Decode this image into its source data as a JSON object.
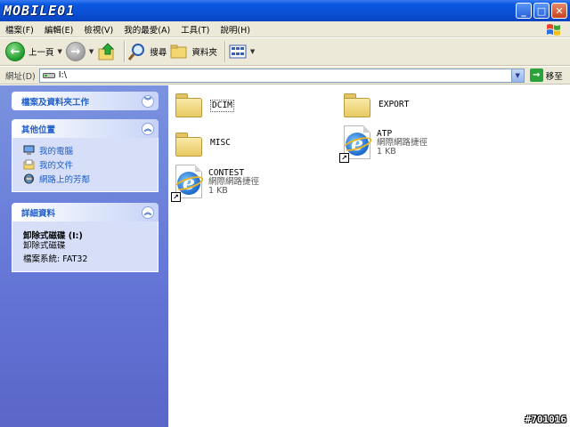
{
  "window": {
    "title_logo": "MOBILE01",
    "buttons": {
      "minimize": "_",
      "maximize": "□",
      "close": "✕"
    }
  },
  "menu": [
    "檔案(F)",
    "編輯(E)",
    "檢視(V)",
    "我的最愛(A)",
    "工具(T)",
    "說明(H)"
  ],
  "toolbar": {
    "back_label": "上一頁",
    "search_label": "搜尋",
    "folders_label": "資料夾"
  },
  "address": {
    "label": "網址(D)",
    "value": "I:\\",
    "go_label": "移至"
  },
  "sidebar": {
    "tasks": {
      "title": "檔案及資料夾工作"
    },
    "places": {
      "title": "其他位置",
      "items": [
        "我的電腦",
        "我的文件",
        "網路上的芳鄰"
      ]
    },
    "details": {
      "title": "詳細資料",
      "drive_name": "卸除式磁碟 (I:)",
      "drive_type": "卸除式磁碟",
      "filesystem": "檔案系統: FAT32"
    }
  },
  "files": [
    {
      "name": "DCIM",
      "type": "folder"
    },
    {
      "name": "EXPORT",
      "type": "folder"
    },
    {
      "name": "MISC",
      "type": "folder"
    },
    {
      "name": "ATP",
      "type": "shortcut",
      "desc": "網際網路捷徑",
      "size": "1 KB"
    },
    {
      "name": "CONTEST",
      "type": "shortcut",
      "desc": "網際網路捷徑",
      "size": "1 KB"
    }
  ],
  "watermark": "#701016",
  "colors": {
    "title_blue": "#0a4fd4",
    "sidebar_blue": "#6374d6",
    "link_blue": "#215dc6"
  },
  "icons": [
    "back-arrow-icon",
    "forward-arrow-icon",
    "up-folder-icon",
    "search-icon",
    "folders-icon",
    "views-icon",
    "drive-icon",
    "go-arrow-icon",
    "folder-icon",
    "ie-shortcut-icon",
    "windows-flag-icon"
  ]
}
